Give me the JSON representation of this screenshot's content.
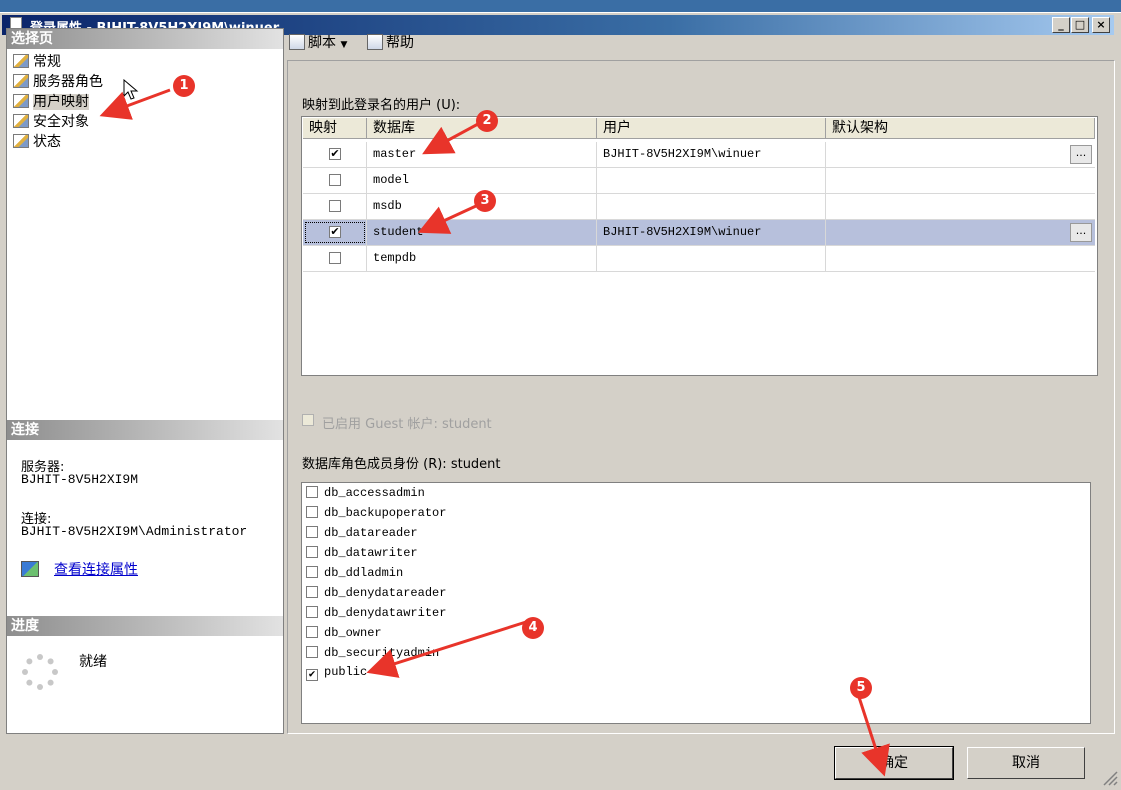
{
  "window": {
    "title": "登录属性 - BJHIT-8V5H2XI9M\\winuer"
  },
  "left": {
    "select_page_header": "选择页",
    "nav_items": [
      {
        "label": "常规"
      },
      {
        "label": "服务器角色"
      },
      {
        "label": "用户映射"
      },
      {
        "label": "安全对象"
      },
      {
        "label": "状态"
      }
    ],
    "connection_header": "连接",
    "server_label": "服务器:",
    "server_value": "BJHIT-8V5H2XI9M",
    "connection_label": "连接:",
    "connection_value": "BJHIT-8V5H2XI9M\\Administrator",
    "view_conn_link": "查看连接属性",
    "progress_header": "进度",
    "progress_status": "就绪"
  },
  "toolbar": {
    "script": "脚本",
    "help": "帮助"
  },
  "mapping": {
    "label": "映射到此登录名的用户 (U):",
    "columns": [
      "映射",
      "数据库",
      "用户",
      "默认架构"
    ],
    "rows": [
      {
        "mapped": true,
        "database": "master",
        "user": "BJHIT-8V5H2XI9M\\winuer",
        "schema": "",
        "ellipsis": "..."
      },
      {
        "mapped": false,
        "database": "model",
        "user": "",
        "schema": ""
      },
      {
        "mapped": false,
        "database": "msdb",
        "user": "",
        "schema": ""
      },
      {
        "mapped": true,
        "database": "student",
        "user": "BJHIT-8V5H2XI9M\\winuer",
        "schema": "",
        "ellipsis": "..."
      },
      {
        "mapped": false,
        "database": "tempdb",
        "user": "",
        "schema": ""
      }
    ]
  },
  "guest": {
    "label": "已启用 Guest 帐户: student"
  },
  "roles": {
    "label": "数据库角色成员身份 (R): student",
    "items": [
      {
        "name": "db_accessadmin",
        "checked": false
      },
      {
        "name": "db_backupoperator",
        "checked": false
      },
      {
        "name": "db_datareader",
        "checked": false
      },
      {
        "name": "db_datawriter",
        "checked": false
      },
      {
        "name": "db_ddladmin",
        "checked": false
      },
      {
        "name": "db_denydatareader",
        "checked": false
      },
      {
        "name": "db_denydatawriter",
        "checked": false
      },
      {
        "name": "db_owner",
        "checked": false
      },
      {
        "name": "db_securityadmin",
        "checked": false
      },
      {
        "name": "public",
        "checked": true
      }
    ]
  },
  "buttons": {
    "ok": "确定",
    "cancel": "取消"
  },
  "annotations": [
    "1",
    "2",
    "3",
    "4",
    "5"
  ],
  "colors": {
    "annotation": "#e8342a",
    "selected_row": "#b7c0dc"
  }
}
